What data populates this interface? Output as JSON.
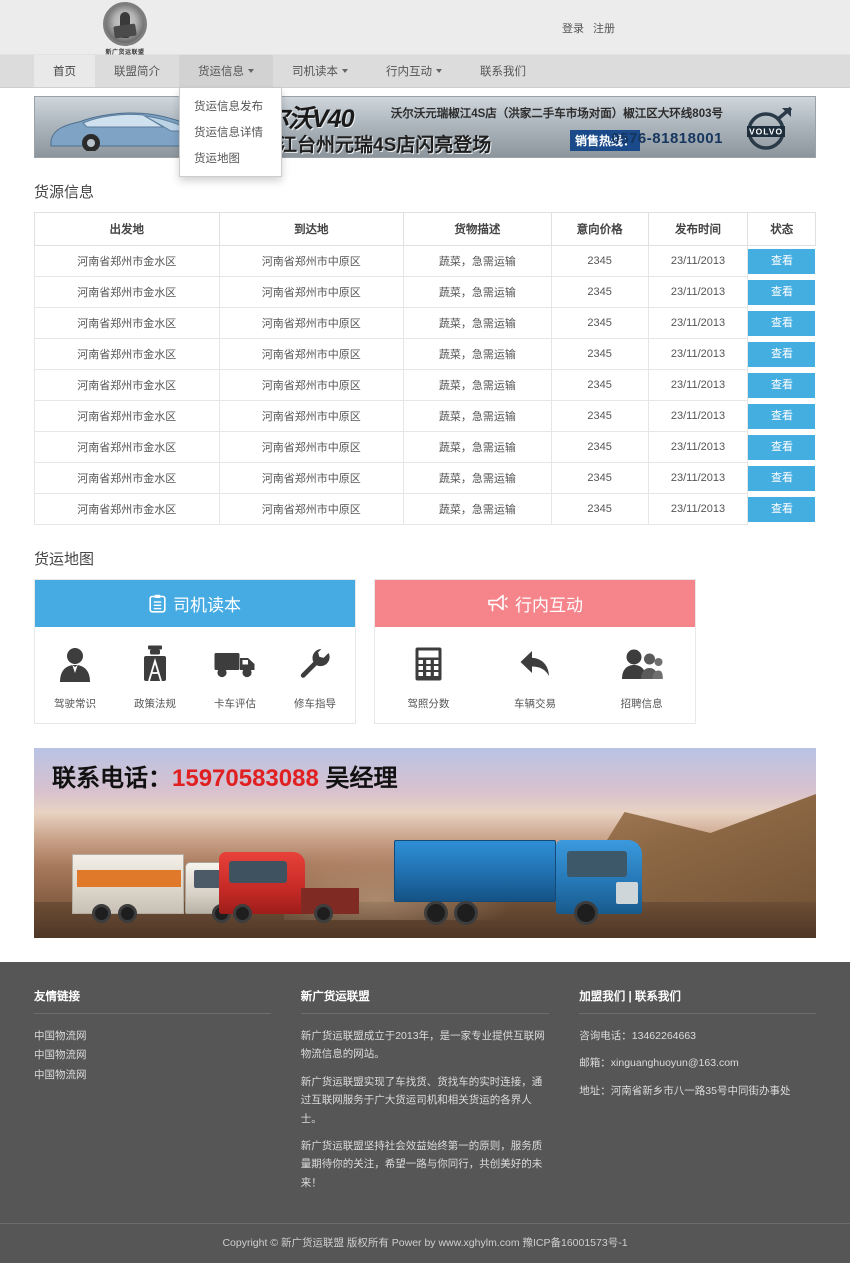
{
  "site": {
    "logo_caption": "新广货运联盟",
    "login_label": "登录",
    "register_label": "注册"
  },
  "nav": {
    "items": [
      {
        "label": "首页",
        "has_caret": false,
        "active": true
      },
      {
        "label": "联盟简介",
        "has_caret": false,
        "active": false
      },
      {
        "label": "货运信息",
        "has_caret": true,
        "active": false
      },
      {
        "label": "司机读本",
        "has_caret": true,
        "active": false
      },
      {
        "label": "行内互动",
        "has_caret": true,
        "active": false
      },
      {
        "label": "联系我们",
        "has_caret": false,
        "active": false
      }
    ],
    "open_dropdown": {
      "items": [
        "货运信息发布",
        "货运信息详情",
        "货运地图"
      ]
    }
  },
  "banner_volvo": {
    "title": "沃尔沃V40",
    "subtitle": "在浙江台州元瑞4S店闪亮登场",
    "address": "沃尔沃元瑞椒江4S店（洪家二手车市场对面）椒江区大环线803号",
    "hotline_label": "销售热线：",
    "hotline_number": "0576-81818001",
    "brand": "VOLVO"
  },
  "goods_section": {
    "title": "货源信息",
    "columns": [
      "出发地",
      "到达地",
      "货物描述",
      "意向价格",
      "发布时间",
      "状态"
    ],
    "action_label": "查看",
    "rows": [
      {
        "from": "河南省郑州市金水区",
        "to": "河南省郑州市中原区",
        "desc": "蔬菜，急需运输",
        "price": "2345",
        "time": "23/11/2013"
      },
      {
        "from": "河南省郑州市金水区",
        "to": "河南省郑州市中原区",
        "desc": "蔬菜，急需运输",
        "price": "2345",
        "time": "23/11/2013"
      },
      {
        "from": "河南省郑州市金水区",
        "to": "河南省郑州市中原区",
        "desc": "蔬菜，急需运输",
        "price": "2345",
        "time": "23/11/2013"
      },
      {
        "from": "河南省郑州市金水区",
        "to": "河南省郑州市中原区",
        "desc": "蔬菜，急需运输",
        "price": "2345",
        "time": "23/11/2013"
      },
      {
        "from": "河南省郑州市金水区",
        "to": "河南省郑州市中原区",
        "desc": "蔬菜，急需运输",
        "price": "2345",
        "time": "23/11/2013"
      },
      {
        "from": "河南省郑州市金水区",
        "to": "河南省郑州市中原区",
        "desc": "蔬菜，急需运输",
        "price": "2345",
        "time": "23/11/2013"
      },
      {
        "from": "河南省郑州市金水区",
        "to": "河南省郑州市中原区",
        "desc": "蔬菜，急需运输",
        "price": "2345",
        "time": "23/11/2013"
      },
      {
        "from": "河南省郑州市金水区",
        "to": "河南省郑州市中原区",
        "desc": "蔬菜，急需运输",
        "price": "2345",
        "time": "23/11/2013"
      },
      {
        "from": "河南省郑州市金水区",
        "to": "河南省郑州市中原区",
        "desc": "蔬菜，急需运输",
        "price": "2345",
        "time": "23/11/2013"
      }
    ]
  },
  "map_section": {
    "title": "货运地图"
  },
  "panels": {
    "driver": {
      "heading": "司机读本",
      "accent": "#46abe3",
      "items": [
        {
          "label": "驾驶常识",
          "icon": "person-icon"
        },
        {
          "label": "政策法规",
          "icon": "police-officer-icon"
        },
        {
          "label": "卡车评估",
          "icon": "truck-icon"
        },
        {
          "label": "修车指导",
          "icon": "wrench-icon"
        }
      ]
    },
    "industry": {
      "heading": "行内互动",
      "accent": "#f5848b",
      "items": [
        {
          "label": "驾照分数",
          "icon": "calculator-icon"
        },
        {
          "label": "车辆交易",
          "icon": "reply-arrow-icon"
        },
        {
          "label": "招聘信息",
          "icon": "group-users-icon"
        }
      ]
    }
  },
  "banner_truck": {
    "contact_label": "联系电话：",
    "phone": "15970583088",
    "manager": "吴经理"
  },
  "footer": {
    "links_col": {
      "heading": "友情链接",
      "links": [
        "中国物流网",
        "中国物流网",
        "中国物流网"
      ]
    },
    "about_col": {
      "heading": "新广货运联盟",
      "paragraphs": [
        "新广货运联盟成立于2013年，是一家专业提供互联网物流信息的网站。",
        "新广货运联盟实现了车找货、货找车的实时连接，通过互联网服务于广大货运司机和相关货运的各界人士。",
        "新广货运联盟坚持社会效益始终第一的原则，服务质量期待你的关注，希望一路与你同行，共创美好的未来！"
      ]
    },
    "contact_col": {
      "heading": "加盟我们 | 联系我们",
      "phone": "咨询电话：13462264663",
      "email": "邮箱：xinguanghuoyun@163.com",
      "address": "地址：河南省新乡市八一路35号中同街办事处"
    },
    "copyright": "Copyright © 新广货运联盟 版权所有 Power by www.xghylm.com 豫ICP备16001573号-1"
  }
}
